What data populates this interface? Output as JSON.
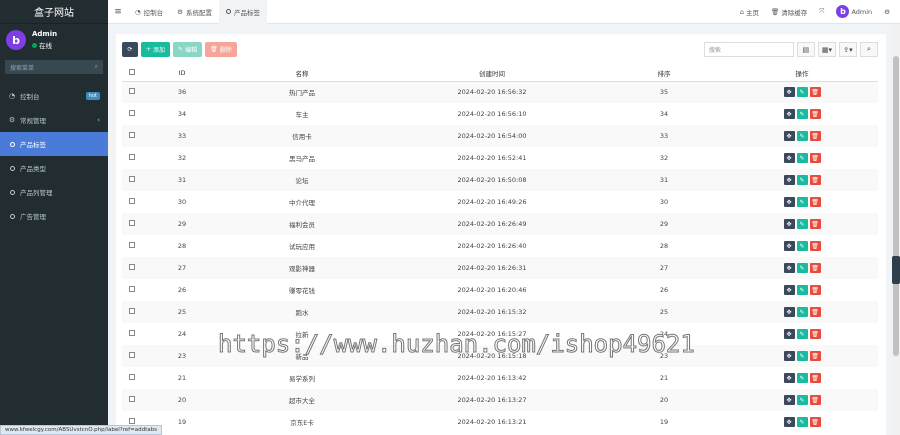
{
  "brand": "盒子网站",
  "user": {
    "avatar_letter": "b",
    "name": "Admin",
    "status": "在线"
  },
  "sidebar": {
    "search_placeholder": "搜索菜单",
    "items": [
      {
        "icon": "dashboard-icon",
        "label": "控制台",
        "badge": "hot"
      },
      {
        "icon": "cogs-icon",
        "label": "常规管理"
      },
      {
        "icon": "circle-icon",
        "label": "产品标签"
      },
      {
        "icon": "circle-icon",
        "label": "产品类型"
      },
      {
        "icon": "circle-icon",
        "label": "产品列管理"
      },
      {
        "icon": "circle-icon",
        "label": "广告管理"
      }
    ]
  },
  "topbar": {
    "tabs": [
      {
        "label": "控制台"
      },
      {
        "label": "系统配置"
      },
      {
        "label": "产品标签"
      }
    ],
    "home": "主页",
    "clear_cache": "清除缓存",
    "admin": "Admin"
  },
  "toolbar": {
    "add": "添加",
    "edit": "编辑",
    "delete": "删除",
    "search_placeholder": "搜索"
  },
  "table": {
    "headers": [
      "ID",
      "名称",
      "创建时间",
      "排序",
      "操作"
    ],
    "rows": [
      {
        "id": "36",
        "name": "热门产品",
        "time": "2024-02-20 16:56:32",
        "sort": "35"
      },
      {
        "id": "34",
        "name": "车主",
        "time": "2024-02-20 16:56:10",
        "sort": "34"
      },
      {
        "id": "33",
        "name": "信用卡",
        "time": "2024-02-20 16:54:00",
        "sort": "33"
      },
      {
        "id": "32",
        "name": "黑马产品",
        "time": "2024-02-20 16:52:41",
        "sort": "32"
      },
      {
        "id": "31",
        "name": "论坛",
        "time": "2024-02-20 16:50:08",
        "sort": "31"
      },
      {
        "id": "30",
        "name": "中介代理",
        "time": "2024-02-20 16:49:26",
        "sort": "30"
      },
      {
        "id": "29",
        "name": "福利会员",
        "time": "2024-02-20 16:26:49",
        "sort": "29"
      },
      {
        "id": "28",
        "name": "试玩应用",
        "time": "2024-02-20 16:26:40",
        "sort": "28"
      },
      {
        "id": "27",
        "name": "观影神器",
        "time": "2024-02-20 16:26:31",
        "sort": "27"
      },
      {
        "id": "26",
        "name": "赚零花钱",
        "time": "2024-02-20 16:20:46",
        "sort": "26"
      },
      {
        "id": "25",
        "name": "跑水",
        "time": "2024-02-20 16:15:32",
        "sort": "25"
      },
      {
        "id": "24",
        "name": "拉新",
        "time": "2024-02-20 16:15:27",
        "sort": "24"
      },
      {
        "id": "23",
        "name": "新品",
        "time": "2024-02-20 16:15:18",
        "sort": "23"
      },
      {
        "id": "21",
        "name": "易学系列",
        "time": "2024-02-20 16:13:42",
        "sort": "21"
      },
      {
        "id": "20",
        "name": "超市大全",
        "time": "2024-02-20 16:13:27",
        "sort": "20"
      },
      {
        "id": "19",
        "name": "京东E卡",
        "time": "2024-02-20 16:13:21",
        "sort": "19"
      }
    ]
  },
  "watermark": "https://www.huzhan.com/ishop49621",
  "status_url": "www.kfwelcgy.com/ABSUvstcnO.php/label?ref=addtabs"
}
